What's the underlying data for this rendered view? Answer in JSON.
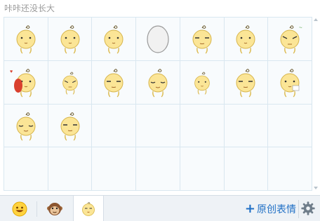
{
  "panel": {
    "title": "咔咔还没长大"
  },
  "emoticons": [
    {
      "name": "standing",
      "icon": "chick-standing-icon"
    },
    {
      "name": "side-turn",
      "icon": "chick-side-icon"
    },
    {
      "name": "look-away",
      "icon": "chick-look-away-icon"
    },
    {
      "name": "egg",
      "icon": "egg-icon"
    },
    {
      "name": "squint",
      "icon": "chick-squint-icon"
    },
    {
      "name": "lying",
      "icon": "chick-lying-icon"
    },
    {
      "name": "sweat",
      "icon": "chick-sweat-icon"
    },
    {
      "name": "hug",
      "icon": "chick-hug-icon"
    },
    {
      "name": "small-angry",
      "icon": "chick-small-angry-icon"
    },
    {
      "name": "smug",
      "icon": "chick-smug-icon"
    },
    {
      "name": "sleepy",
      "icon": "chick-sleepy-icon"
    },
    {
      "name": "small-calm",
      "icon": "chick-small-calm-icon"
    },
    {
      "name": "meh",
      "icon": "chick-meh-icon"
    },
    {
      "name": "cry",
      "icon": "chick-cry-icon"
    },
    {
      "name": "content",
      "icon": "chick-content-icon"
    },
    {
      "name": "cool",
      "icon": "chick-cool-icon"
    }
  ],
  "tabs": [
    {
      "name": "smiley-tab",
      "icon": "smiley-face-icon"
    },
    {
      "name": "monkey-tab",
      "icon": "monkey-face-icon"
    },
    {
      "name": "chick-tab",
      "icon": "chick-face-icon",
      "active": true
    }
  ],
  "footer": {
    "create_label": "原创表情",
    "create_plus": "+"
  },
  "colors": {
    "grid_line": "#d9e7f0",
    "accent": "#1f6fc5",
    "footer_bg": "#eef2f6",
    "chick": "#fbe596"
  }
}
